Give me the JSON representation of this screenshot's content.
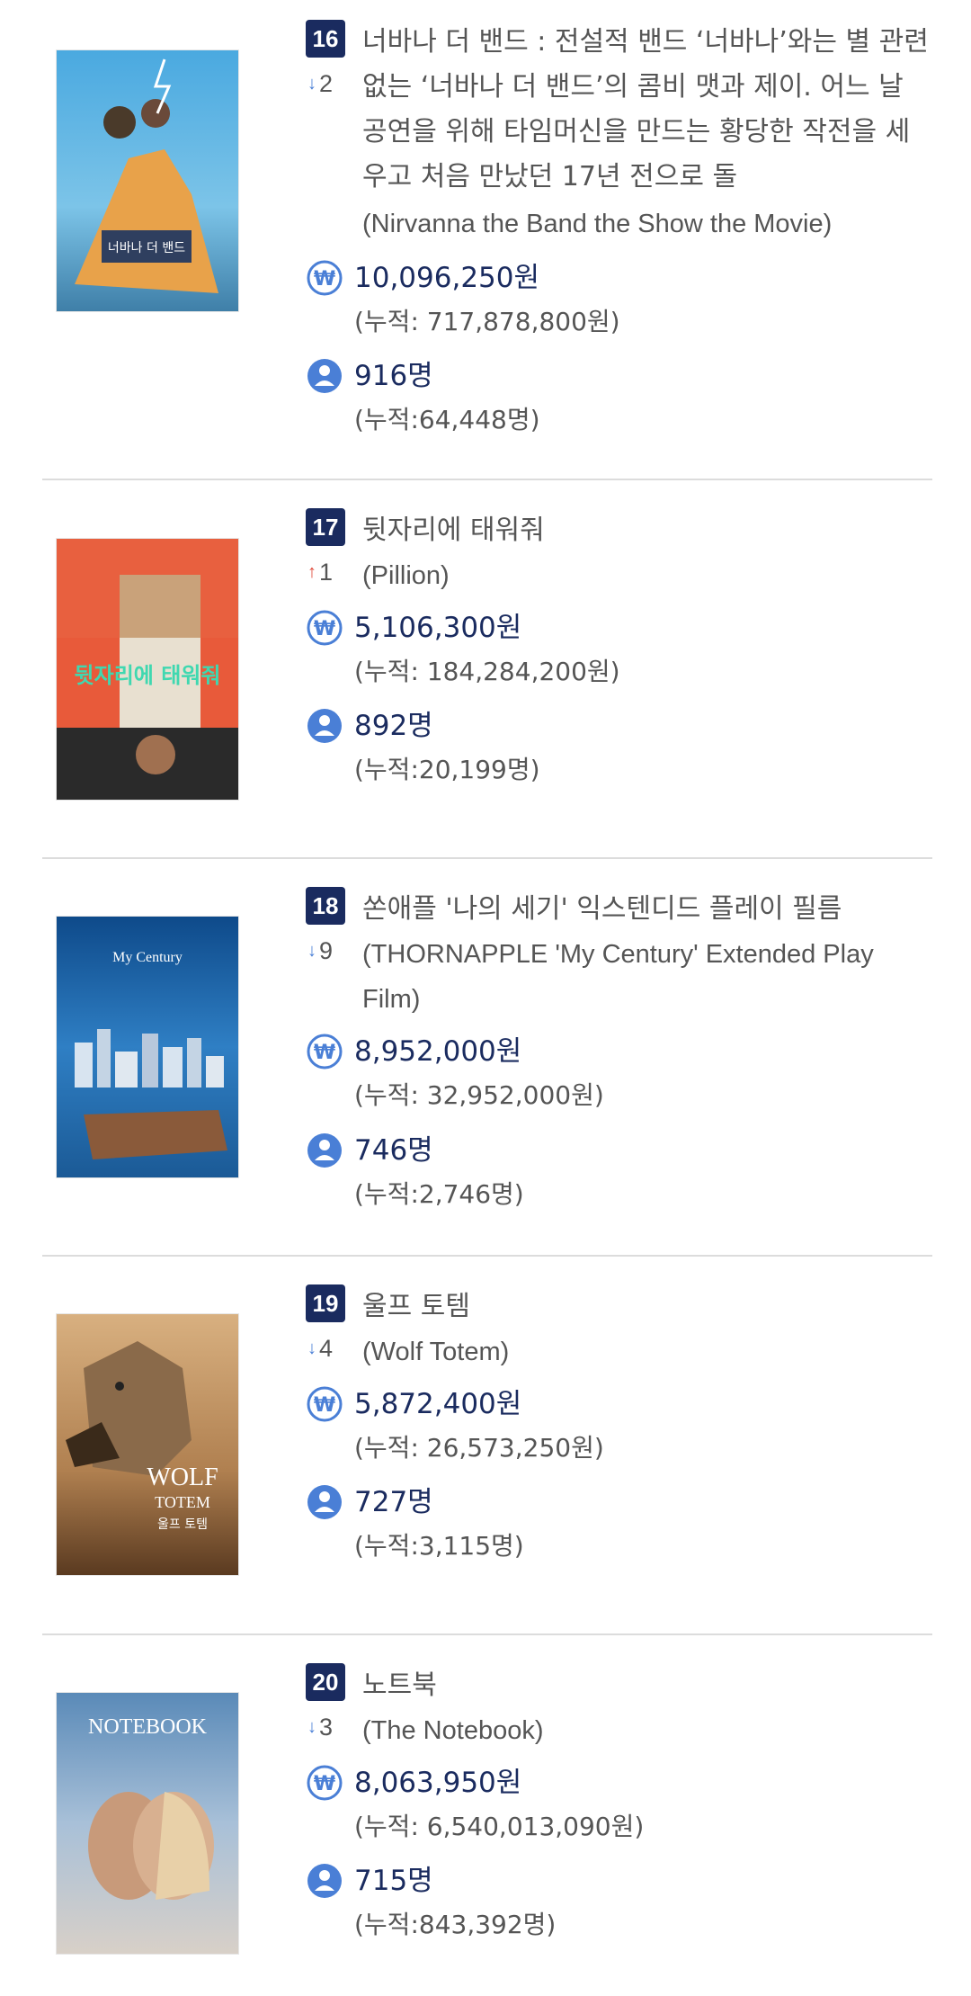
{
  "entries": [
    {
      "rank": "16",
      "change_dir": "down",
      "change_arrow": "↓",
      "change_value": "2",
      "title_ko": "너바나 더 밴드 : 전설적 밴드 ‘너바나’와는 별 관련 없는 ‘너바나 더 밴드’의 콤비 맷과 제이. 어느 날 공연을 위해 타임머신을 만드는 황당한 작전을 세우고 처음 만났던 17년 전으로 돌",
      "title_en": "(Nirvanna the Band the Show the Movie)",
      "revenue": "10,096,250원",
      "revenue_total": "(누적: 717,878,800원)",
      "audience": "916명",
      "audience_total": "(누적:64,448명)",
      "poster_icon": "movie-poster"
    },
    {
      "rank": "17",
      "change_dir": "up",
      "change_arrow": "↑",
      "change_value": "1",
      "title_ko": "뒷자리에 태워줘",
      "title_en": "(Pillion)",
      "revenue": "5,106,300원",
      "revenue_total": "(누적: 184,284,200원)",
      "audience": "892명",
      "audience_total": "(누적:20,199명)",
      "poster_icon": "movie-poster"
    },
    {
      "rank": "18",
      "change_dir": "down",
      "change_arrow": "↓",
      "change_value": "9",
      "title_ko": "쏜애플 '나의 세기' 익스텐디드 플레이 필름",
      "title_en": "(THORNAPPLE 'My Century' Extended Play Film)",
      "revenue": "8,952,000원",
      "revenue_total": "(누적: 32,952,000원)",
      "audience": "746명",
      "audience_total": "(누적:2,746명)",
      "poster_icon": "movie-poster"
    },
    {
      "rank": "19",
      "change_dir": "down",
      "change_arrow": "↓",
      "change_value": "4",
      "title_ko": "울프 토템",
      "title_en": "(Wolf Totem)",
      "revenue": "5,872,400원",
      "revenue_total": "(누적: 26,573,250원)",
      "audience": "727명",
      "audience_total": "(누적:3,115명)",
      "poster_icon": "movie-poster"
    },
    {
      "rank": "20",
      "change_dir": "down",
      "change_arrow": "↓",
      "change_value": "3",
      "title_ko": "노트북",
      "title_en": "(The Notebook)",
      "revenue": "8,063,950원",
      "revenue_total": "(누적: 6,540,013,090원)",
      "audience": "715명",
      "audience_total": "(누적:843,392명)",
      "poster_icon": "movie-poster"
    }
  ],
  "icons": {
    "revenue_icon": "won-icon",
    "audience_icon": "person-icon"
  },
  "colors": {
    "accent": "#1a2b5f",
    "icon_blue": "#4a7fd6",
    "rank_up": "#e04a3a",
    "rank_down": "#4a7fd6",
    "text_gray": "#555555",
    "divider": "#dcdcdc"
  },
  "poster_texts": {
    "p16": "너바나 더 밴드",
    "p17": "뒷자리에 태워줘",
    "p18": "My Century",
    "p19a": "WOLF",
    "p19b": "TOTEM",
    "p19c": "울프 토템",
    "p20": "NOTEBOOK"
  }
}
